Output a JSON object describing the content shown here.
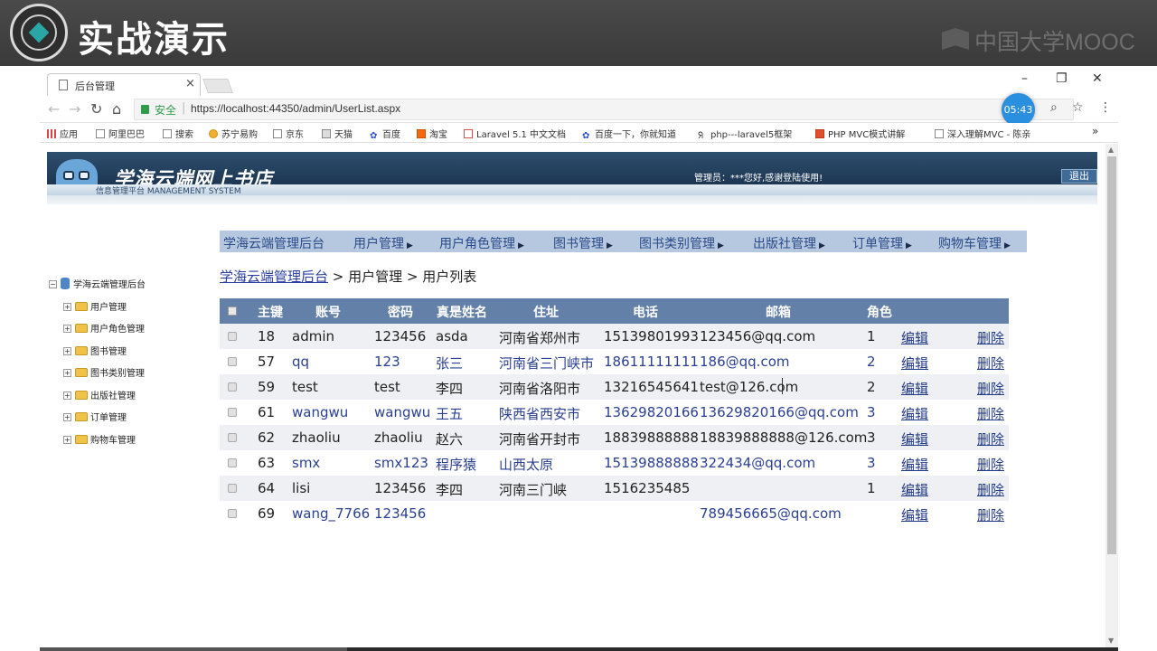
{
  "banner": {
    "title": "实战演示",
    "brand": "中国大学MOOC"
  },
  "browser": {
    "tab_title": "后台管理",
    "tab_close": "×",
    "window_min": "–",
    "window_restore": "❐",
    "window_close": "✕",
    "secure_label": "安全",
    "url": "https://localhost:44350/admin/UserList.aspx",
    "timer": "05:43",
    "bookmarks": [
      "应用",
      "阿里巴巴",
      "搜索",
      "苏宁易购",
      "京东",
      "天猫",
      "百度",
      "淘宝",
      "Laravel 5.1 中文文档",
      "百度一下，你就知道",
      "php---laravel5框架",
      "PHP MVC模式讲解",
      "深入理解MVC - 陈亲"
    ],
    "more_bookmarks": "»"
  },
  "site": {
    "title": "学海云端网上书店",
    "subtitle": "信息管理平台 MANAGEMENT SYSTEM",
    "greeting": "管理员：***您好,感谢登陆使用!",
    "logout": "退出"
  },
  "topnav": [
    "学海云端管理后台",
    "用户管理",
    "用户角色管理",
    "图书管理",
    "图书类别管理",
    "出版社管理",
    "订单管理",
    "购物车管理"
  ],
  "breadcrumb": {
    "home": "学海云端管理后台",
    "rest": " > 用户管理 > 用户列表"
  },
  "tree": {
    "root": "学海云端管理后台",
    "items": [
      "用户管理",
      "用户角色管理",
      "图书管理",
      "图书类别管理",
      "出版社管理",
      "订单管理",
      "购物车管理"
    ]
  },
  "table": {
    "headers": [
      "主键",
      "账号",
      "密码",
      "真是姓名",
      "住址",
      "电话",
      "邮箱",
      "角色"
    ],
    "edit_label": "编辑",
    "delete_label": "删除",
    "rows": [
      {
        "id": "18",
        "account": "admin",
        "password": "123456",
        "name": "asda",
        "address": "河南省郑州市",
        "phone": "15139801993",
        "email": "123456@qq.com",
        "role": "1"
      },
      {
        "id": "57",
        "account": "qq",
        "password": "123",
        "name": "张三",
        "address": "河南省三门峡市",
        "phone": "18611111111",
        "email": "186@qq.com",
        "role": "2"
      },
      {
        "id": "59",
        "account": "test",
        "password": "test",
        "name": "李四",
        "address": "河南省洛阳市",
        "phone": "13216545641",
        "email": "test@126.com",
        "role": "2"
      },
      {
        "id": "61",
        "account": "wangwu",
        "password": "wangwu",
        "name": "王五",
        "address": "陕西省西安市",
        "phone": "13629820166",
        "email": "13629820166@qq.com",
        "role": "3"
      },
      {
        "id": "62",
        "account": "zhaoliu",
        "password": "zhaoliu",
        "name": "赵六",
        "address": "河南省开封市",
        "phone": "18839888888",
        "email": "18839888888@126.com",
        "role": "3"
      },
      {
        "id": "63",
        "account": "smx",
        "password": "smx123",
        "name": "程序猿",
        "address": "山西太原",
        "phone": "15139888888",
        "email": "322434@qq.com",
        "role": "3"
      },
      {
        "id": "64",
        "account": "lisi",
        "password": "123456",
        "name": "李四",
        "address": "河南三门峡",
        "phone": "1516235485",
        "email": "",
        "role": "1"
      },
      {
        "id": "69",
        "account": "wang_7766",
        "password": "123456",
        "name": "",
        "address": "",
        "phone": "",
        "email": "789456665@qq.com",
        "role": ""
      }
    ]
  },
  "colors": {
    "header_bg": "#6381a8",
    "nav_bg": "#b6c8df",
    "link": "#223a8a",
    "banner_bg": "#3a3a3a"
  }
}
